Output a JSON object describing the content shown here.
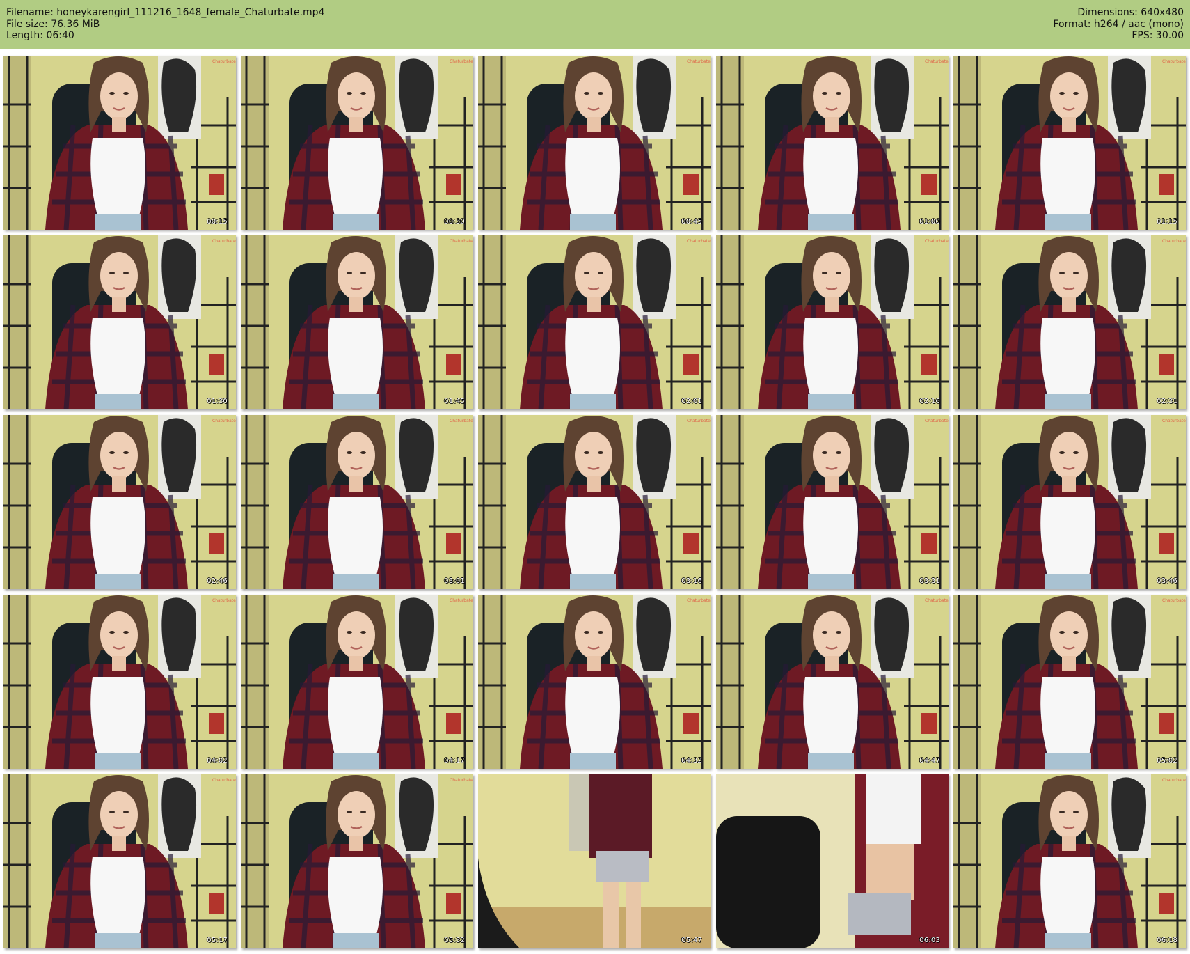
{
  "header": {
    "filename_line": "Filename: honeykarengirl_111216_1648_female_Chaturbate.mp4",
    "filesize_line": "File size: 76.36 MiB",
    "length_line": "Length: 06:40",
    "dimensions_line": "Dimensions: 640x480",
    "format_line": "Format: h264 / aac (mono)",
    "fps_line": "FPS: 30.00",
    "background_color": "#b1cc83"
  },
  "thumbnails": [
    {
      "timestamp": "00:15"
    },
    {
      "timestamp": "00:30"
    },
    {
      "timestamp": "00:45"
    },
    {
      "timestamp": "01:00"
    },
    {
      "timestamp": "01:15"
    },
    {
      "timestamp": "01:30"
    },
    {
      "timestamp": "01:45"
    },
    {
      "timestamp": "02:01"
    },
    {
      "timestamp": "02:16"
    },
    {
      "timestamp": "02:31"
    },
    {
      "timestamp": "02:46"
    },
    {
      "timestamp": "03:01"
    },
    {
      "timestamp": "03:16"
    },
    {
      "timestamp": "03:31"
    },
    {
      "timestamp": "03:46"
    },
    {
      "timestamp": "04:02"
    },
    {
      "timestamp": "04:17"
    },
    {
      "timestamp": "04:32"
    },
    {
      "timestamp": "04:47"
    },
    {
      "timestamp": "05:02"
    },
    {
      "timestamp": "05:17"
    },
    {
      "timestamp": "05:32"
    },
    {
      "timestamp": "05:47"
    },
    {
      "timestamp": "06:03"
    },
    {
      "timestamp": "06:18"
    }
  ]
}
